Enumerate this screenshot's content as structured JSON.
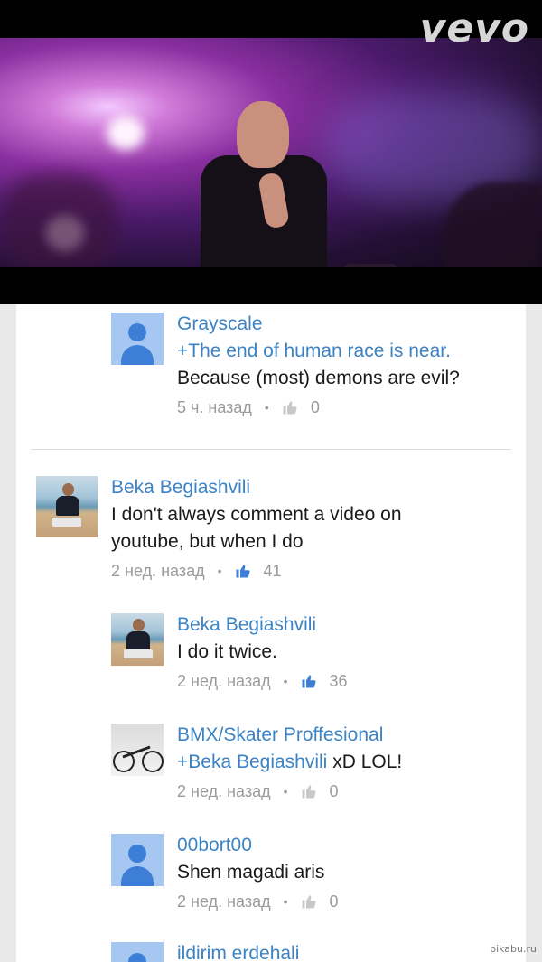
{
  "video": {
    "logo": "vevo"
  },
  "comments": [
    {
      "author": "Grayscale",
      "mention": "+The end of human race is near.",
      "text": "Because (most) demons are evil?",
      "time": "5 ч. назад",
      "likes": "0",
      "liked": false
    },
    {
      "author": "Beka Begiashvili",
      "text": "I don't always comment a video on youtube, but when I do",
      "time": "2 нед. назад",
      "likes": "41",
      "liked": true
    },
    {
      "author": "Beka Begiashvili",
      "text": "I do it twice.",
      "time": "2 нед. назад",
      "likes": "36",
      "liked": true
    },
    {
      "author": "BMX/Skater Proffesional",
      "mention": "+Beka Begiashvili",
      "text": " xD LOL!",
      "time": "2 нед. назад",
      "likes": "0",
      "liked": false
    },
    {
      "author": "00bort00",
      "text": "Shen magadi aris",
      "time": "2 нед. назад",
      "likes": "0",
      "liked": false
    },
    {
      "author": "ildirim erdehali"
    }
  ],
  "colors": {
    "link": "#3d83c4",
    "liked_thumb": "#3d7fd6",
    "unliked_thumb": "#c8c8c8"
  },
  "watermark": "pikabu.ru"
}
